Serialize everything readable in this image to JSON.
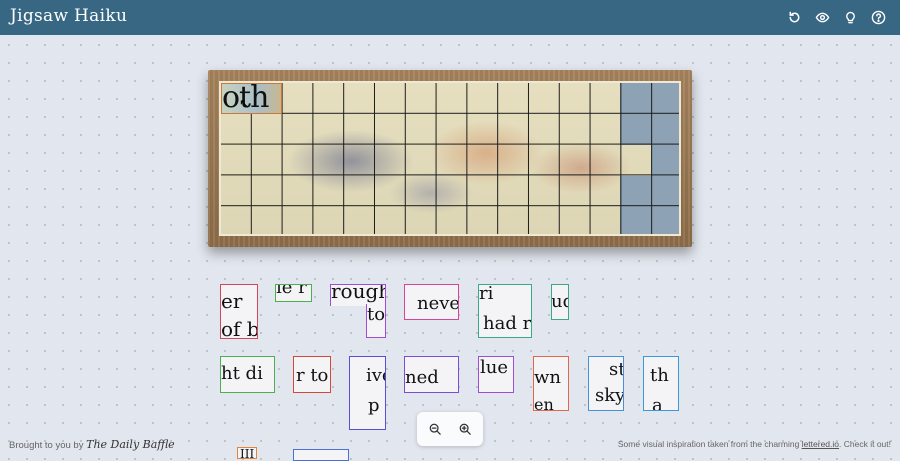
{
  "app": {
    "title": "Jigsaw Haiku"
  },
  "toolbar": {
    "icons": [
      "restart-icon",
      "eye-icon",
      "lightbulb-icon",
      "help-icon"
    ]
  },
  "board": {
    "rows": 5,
    "cols": 15,
    "placed_piece_text": "oth",
    "colors": {
      "board": "#e3dcbd",
      "empty_slot": "#8da2b5",
      "frame": "#9a7a53"
    }
  },
  "pieces": [
    {
      "text": [
        "er",
        "of b"
      ],
      "color": "#d3465a"
    },
    {
      "text": [
        "ie r"
      ],
      "color": "#4caf50"
    },
    {
      "text": [
        "rough",
        "to"
      ],
      "color": "#9c4ed4"
    },
    {
      "text": [
        "neve"
      ],
      "color": "#d4469a"
    },
    {
      "text": [
        "ri",
        "had r"
      ],
      "color": "#3aa98a"
    },
    {
      "text": [
        "ud"
      ],
      "color": "#3aa98a"
    },
    {
      "text": [
        "ht di"
      ],
      "color": "#4caf50"
    },
    {
      "text": [
        "r to"
      ],
      "color": "#d6473a"
    },
    {
      "text": [
        "ive",
        "p"
      ],
      "color": "#5a4ed4"
    },
    {
      "text": [
        "ned"
      ],
      "color": "#7a4ed4"
    },
    {
      "text": [
        "lue"
      ],
      "color": "#9c4ed4"
    },
    {
      "text": [
        "wn",
        "en"
      ],
      "color": "#e0684a"
    },
    {
      "text": [
        "st",
        "sky"
      ],
      "color": "#4a90d9"
    },
    {
      "text": [
        "th",
        "a"
      ],
      "color": "#3a9ad9"
    },
    {
      "text": [
        "III"
      ],
      "color": "#e0843a"
    },
    {
      "text": [
        ""
      ],
      "color": "#4a70d9"
    }
  ],
  "footer": {
    "left_prefix": "Brought to you by",
    "left_brand": "The Daily Baffle",
    "right_text": "Some visual inspiration taken from the charming",
    "right_link": "lettered.io",
    "right_suffix": ". Check it out!"
  }
}
